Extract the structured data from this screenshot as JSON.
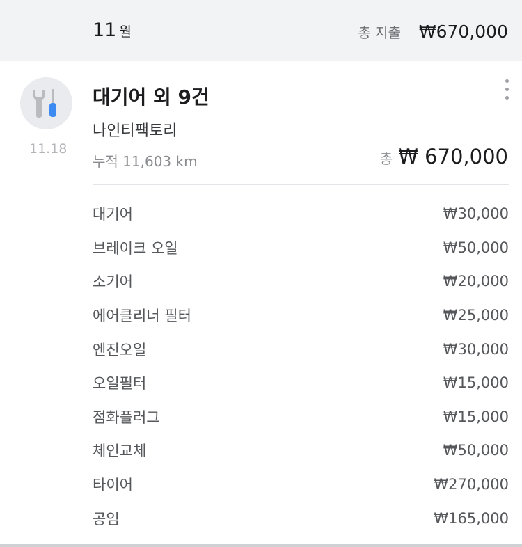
{
  "header": {
    "month": "11",
    "month_unit": "월",
    "total_label": "총 지출",
    "total_amount": "₩670,000"
  },
  "record": {
    "icon": "maintenance-tools-icon",
    "date": "11.18",
    "title": "대기어 외 9건",
    "shop": "나인티팩토리",
    "mileage": "누적 11,603 km",
    "total_label": "총",
    "total_amount": "₩ 670,000",
    "more_icon": "more-vertical-icon",
    "items": [
      {
        "name": "대기어",
        "amount": "₩30,000"
      },
      {
        "name": "브레이크 오일",
        "amount": "₩50,000"
      },
      {
        "name": "소기어",
        "amount": "₩20,000"
      },
      {
        "name": "에어클리너 필터",
        "amount": "₩25,000"
      },
      {
        "name": "엔진오일",
        "amount": "₩30,000"
      },
      {
        "name": "오일필터",
        "amount": "₩15,000"
      },
      {
        "name": "점화플러그",
        "amount": "₩15,000"
      },
      {
        "name": "체인교체",
        "amount": "₩50,000"
      },
      {
        "name": "타이어",
        "amount": "₩270,000"
      },
      {
        "name": "공임",
        "amount": "₩165,000"
      }
    ]
  },
  "colors": {
    "header_bg": "#f2f3f5",
    "icon_bg": "#eaebee",
    "icon_grey": "#b9bbbf",
    "accent_blue": "#3d8bf2"
  }
}
